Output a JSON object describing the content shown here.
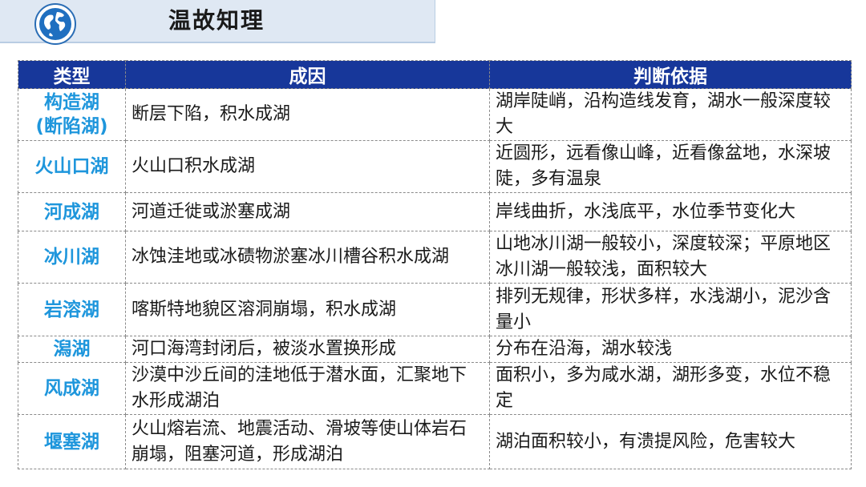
{
  "header": {
    "title": "温故知理",
    "icon": "globe-icon"
  },
  "table": {
    "columns": [
      "类型",
      "成因",
      "判断依据"
    ],
    "rows": [
      {
        "type": "构造湖\n(断陷湖)",
        "cause": "断层下陷，积水成湖",
        "basis": "湖岸陡峭，沿构造线发育，湖水一般深度较大"
      },
      {
        "type": "火山口湖",
        "cause": "火山口积水成湖",
        "basis": "近圆形，远看像山峰，近看像盆地，水深坡陡，多有温泉"
      },
      {
        "type": "河成湖",
        "cause": "河道迁徙或淤塞成湖",
        "basis": "岸线曲折，水浅底平，水位季节变化大"
      },
      {
        "type": "冰川湖",
        "cause": "冰蚀洼地或冰碛物淤塞冰川槽谷积水成湖",
        "basis": "山地冰川湖一般较小，深度较深；平原地区冰川湖一般较浅，面积较大"
      },
      {
        "type": "岩溶湖",
        "cause": "喀斯特地貌区溶洞崩塌，积水成湖",
        "basis": "排列无规律，形状多样，水浅湖小，泥沙含量小"
      },
      {
        "type": "潟湖",
        "cause": "河口海湾封闭后，被淡水置换形成",
        "basis": "分布在沿海，湖水较浅"
      },
      {
        "type": "风成湖",
        "cause": "沙漠中沙丘间的洼地低于潜水面，汇聚地下水形成湖泊",
        "basis": "面积小，多为咸水湖，湖形多变，水位不稳定"
      },
      {
        "type": "堰塞湖",
        "cause": "火山熔岩流、地震活动、滑坡等使山体岩石崩塌，阻塞河道，形成湖泊",
        "basis": "湖泊面积较小，有溃提风险，危害较大"
      }
    ]
  }
}
